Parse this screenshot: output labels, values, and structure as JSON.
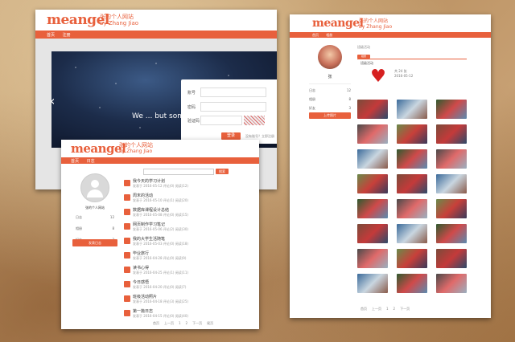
{
  "brand": {
    "logo": "meangel",
    "subtitle_cn": "张的个人网站",
    "subtitle_en": "by Zhang Jiao",
    "accent": "#e8603c"
  },
  "window_login": {
    "nav": [
      "首页",
      "注册"
    ],
    "banner_text": "We ... but some of...",
    "form": {
      "username_label": "账号",
      "password_label": "密码",
      "captcha_label": "验证码",
      "submit_label": "登录",
      "register_link": "没有账号？立即注册"
    }
  },
  "window_list": {
    "nav": [
      "首页",
      "日志"
    ],
    "profile": {
      "name": "张的个人网站",
      "stats": [
        {
          "label": "日志",
          "value": "12"
        },
        {
          "label": "相册",
          "value": "8"
        },
        {
          "label": "好友",
          "value": "3"
        }
      ],
      "button": "发表日志"
    },
    "search": {
      "placeholder": "",
      "button": "搜索"
    },
    "posts": [
      {
        "title": "我今天的学习计划",
        "meta": "发表于 2016-05-12 评论(0) 阅读(12)"
      },
      {
        "title": "周末的活动",
        "meta": "发表于 2016-05-10 评论(1) 阅读(20)"
      },
      {
        "title": "数据库课程设计总结",
        "meta": "发表于 2016-05-08 评论(0) 阅读(15)"
      },
      {
        "title": "网页制作学习笔记",
        "meta": "发表于 2016-05-06 评论(2) 阅读(30)"
      },
      {
        "title": "我的大学生活随笔",
        "meta": "发表于 2016-05-03 评论(0) 阅读(18)"
      },
      {
        "title": "毕业旅行",
        "meta": "发表于 2016-04-28 评论(0) 阅读(9)"
      },
      {
        "title": "读书心得",
        "meta": "发表于 2016-04-25 评论(1) 阅读(11)"
      },
      {
        "title": "今日感悟",
        "meta": "发表于 2016-04-20 评论(0) 阅读(7)"
      },
      {
        "title": "班级活动照片",
        "meta": "发表于 2016-04-18 评论(3) 阅读(25)"
      },
      {
        "title": "第一篇日志",
        "meta": "发表于 2016-04-15 评论(0) 阅读(40)"
      }
    ],
    "pagination": [
      "首页",
      "上一页",
      "1",
      "2",
      "下一页",
      "尾页"
    ]
  },
  "window_album": {
    "nav": [
      "首页",
      "相册"
    ],
    "profile": {
      "name": "张",
      "stats": [
        {
          "label": "日志",
          "value": "12"
        },
        {
          "label": "相册",
          "value": "8"
        },
        {
          "label": "好友",
          "value": "3"
        }
      ],
      "button": "上传照片"
    },
    "album_tab": "相册",
    "album_title": "班级活动",
    "album_info": [
      "共 24 张",
      "2016-05-12"
    ],
    "photos_rows": 8,
    "pagination": [
      "首页",
      "上一页",
      "1",
      "2",
      "下一页"
    ]
  }
}
